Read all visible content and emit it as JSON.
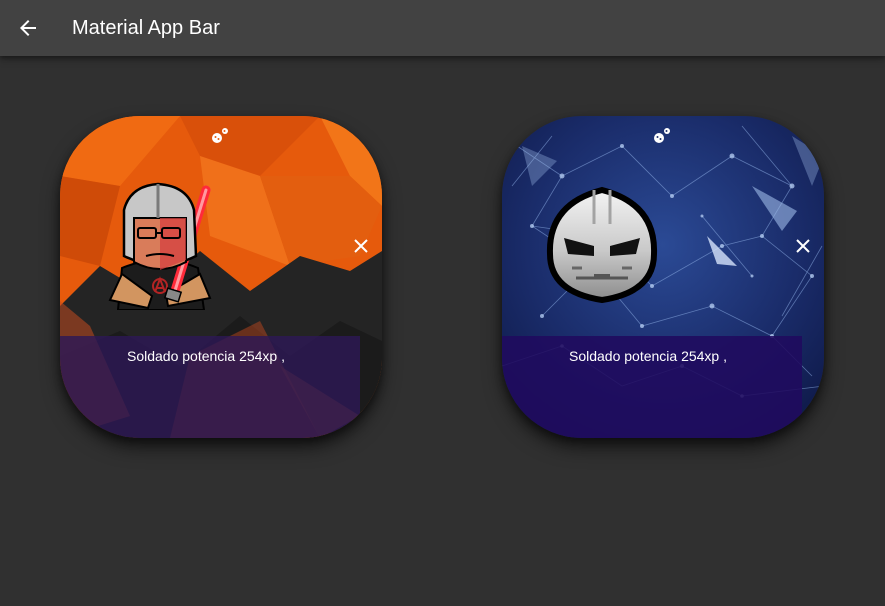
{
  "appbar": {
    "title": "Material App Bar",
    "back_icon": "arrow-back-icon"
  },
  "cards": [
    {
      "caption": "Soldado potencia 254xp ,",
      "top_icon": "gamepad-icon",
      "close_icon": "close-icon",
      "theme_color": "#e8580a"
    },
    {
      "caption": "Soldado potencia 254xp ,",
      "top_icon": "gamepad-icon",
      "close_icon": "close-icon",
      "theme_color": "#1e2f6b"
    }
  ]
}
